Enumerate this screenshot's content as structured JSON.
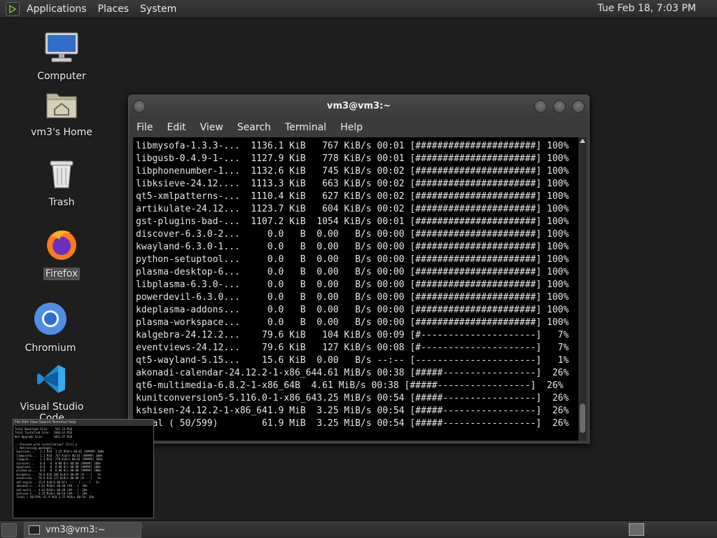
{
  "top_panel": {
    "menus": [
      "Applications",
      "Places",
      "System"
    ],
    "clock": "Tue Feb 18,  7:03 PM"
  },
  "desktop_icons": [
    {
      "label": "Computer",
      "icon": "computer-icon"
    },
    {
      "label": "vm3's Home",
      "icon": "home-folder-icon"
    },
    {
      "label": "Trash",
      "icon": "trash-icon"
    },
    {
      "label": "Firefox",
      "icon": "firefox-icon"
    },
    {
      "label": "Chromium",
      "icon": "chromium-icon"
    },
    {
      "label": "Visual Studio Code",
      "icon": "vscode-icon"
    }
  ],
  "terminal": {
    "title": "vm3@vm3:~",
    "menu": [
      "File",
      "Edit",
      "View",
      "Search",
      "Terminal",
      "Help"
    ],
    "lines": [
      "libmysofa-1.3.3-...  1136.1 KiB   767 KiB/s 00:01 [######################] 100%",
      "libgusb-0.4.9-1-...  1127.9 KiB   778 KiB/s 00:01 [######################] 100%",
      "libphonenumber-1...  1132.6 KiB   745 KiB/s 00:02 [######################] 100%",
      "libksieve-24.12....  1113.3 KiB   663 KiB/s 00:02 [######################] 100%",
      "qt5-xmlpatterns-...  1110.4 KiB   627 KiB/s 00:02 [######################] 100%",
      "artikulate-24.12...  1123.7 KiB   604 KiB/s 00:02 [######################] 100%",
      "gst-plugins-bad-...  1107.2 KiB  1054 KiB/s 00:01 [######################] 100%",
      "discover-6.3.0-2...     0.0   B  0.00   B/s 00:00 [######################] 100%",
      "kwayland-6.3.0-1...     0.0   B  0.00   B/s 00:00 [######################] 100%",
      "python-setuptool...     0.0   B  0.00   B/s 00:00 [######################] 100%",
      "plasma-desktop-6...     0.0   B  0.00   B/s 00:00 [######################] 100%",
      "libplasma-6.3.0-...     0.0   B  0.00   B/s 00:00 [######################] 100%",
      "powerdevil-6.3.0...     0.0   B  0.00   B/s 00:00 [######################] 100%",
      "kdeplasma-addons...     0.0   B  0.00   B/s 00:00 [######################] 100%",
      "plasma-workspace...     0.0   B  0.00   B/s 00:00 [######################] 100%",
      "kalgebra-24.12.2...    79.6 KiB   104 KiB/s 00:09 [#---------------------]   7%",
      "eventviews-24.12...    79.6 KiB   127 KiB/s 00:08 [#---------------------]   7%",
      "qt5-wayland-5.15...    15.6 KiB  0.00   B/s --:-- [----------------------]   1%",
      "akonadi-calendar-24.12.2-1-x86_644.61 MiB/s 00:38 [#####-----------------]  26%",
      "qt6-multimedia-6.8.2-1-x86_64B  4.61 MiB/s 00:38 [#####-----------------]  26%",
      "kunitconversion5-5.116.0-1-x86_643.25 MiB/s 00:54 [#####-----------------]  26%",
      "kshisen-24.12.2-1-x86_641.9 MiB  3.25 MiB/s 00:54 [#####-----------------]  26%",
      "Total ( 50/599)        61.9 MiB  3.25 MiB/s 00:54 [#####-----------------]  26%"
    ]
  },
  "preview": {
    "menu": "File  Edit  View  Search  Terminal  Help",
    "lines": [
      "Total Download Size:    541.33 MiB",
      "Total Installed Size:  1846.61 MiB",
      "Net Upgrade Size:      1052.97 MiB",
      "",
      ":: Proceed with installation? [Y/n] y",
      ":: Retrieving packages...",
      " kunitcon...   3.1 MiB  3.25 MiB/s 00:01 [#####] 100%",
      " libmysofa...  1.1 MiB  767 KiB/s 00:01 [#####] 100%",
      " libgusb...    1.1 MiB  778 KiB/s 00:01 [#####] 100%",
      " discover...   0.0   B  0.00 B/s 00:00 [#####] 100%",
      " kwayland...   0.0   B  0.00 B/s 00:00 [#####] 100%",
      " plasma-wo...  0.0   B  0.00 B/s 00:00 [#####] 100%",
      " kalgebra...  79.6 KiB 104 KiB/s 00:09 [#----]   7%",
      " eventview... 79.6 KiB 127 KiB/s 00:08 [#----]   7%",
      " qt5-wayla... 15.6 KiB 0.00 B/s --:-- [-----]   1%",
      " akonadi-c... 4.61 MiB/s 00:38 [##---]  26%",
      " qt6-multi... 4.61 MiB/s 00:38 [##---]  26%",
      " kshisen-2... 3.25 MiB/s 00:54 [##---]  26%",
      " Total ( 50/599) 61.9 MiB 3.25 MiB/s 00:54  26%"
    ]
  },
  "taskbar": {
    "task_label": "vm3@vm3:~"
  }
}
